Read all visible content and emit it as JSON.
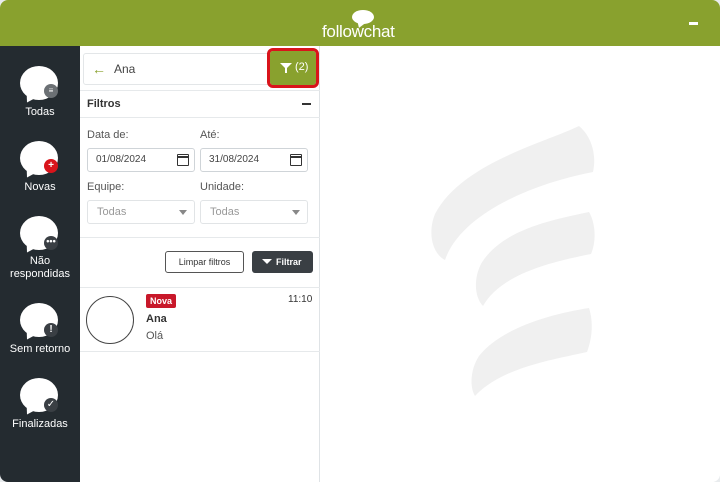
{
  "header": {
    "brand": "followchat",
    "minimize_icon": "minimize-icon",
    "color": "#89a12e"
  },
  "sidebar": {
    "items": [
      {
        "label": "Todas",
        "badge_icon": "list-icon",
        "badge_color": "#6b7074"
      },
      {
        "label": "Novas",
        "badge_icon": "plus-icon",
        "badge_color": "#d9141b"
      },
      {
        "label_line1": "Não",
        "label_line2": "respondidas",
        "badge_icon": "ellipsis-icon",
        "badge_color": "#3a3f44"
      },
      {
        "label": "Sem retorno",
        "badge_icon": "exclamation-icon",
        "badge_color": "#3a3f44"
      },
      {
        "label": "Finalizadas",
        "badge_icon": "check-icon",
        "badge_color": "#3a3f44"
      }
    ]
  },
  "search": {
    "value": "Ana",
    "back_icon": "arrow-left-icon",
    "filter_button_label": "(2)",
    "filter_icon": "filter-icon"
  },
  "filters": {
    "title": "Filtros",
    "collapse_icon": "minus-icon",
    "date_from_label": "Data de:",
    "date_from_value": "01/08/2024",
    "date_to_label": "Até:",
    "date_to_value": "31/08/2024",
    "team_label": "Equipe:",
    "team_value": "Todas",
    "unit_label": "Unidade:",
    "unit_value": "Todas",
    "clear_button": "Limpar filtros",
    "apply_button": "Filtrar"
  },
  "chats": [
    {
      "badge": "Nova",
      "name": "Ana",
      "preview": "Olá",
      "time": "11:10"
    }
  ]
}
